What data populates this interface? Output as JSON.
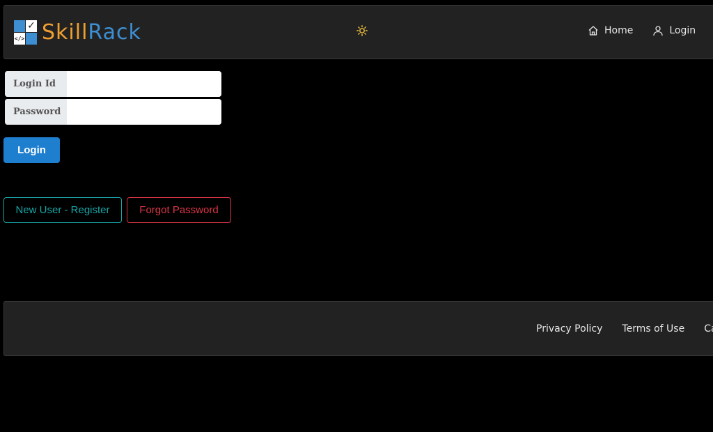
{
  "brand": {
    "part1": "Skill",
    "part2": "Rack",
    "logo_check": "✓",
    "logo_code": "</>"
  },
  "header": {
    "theme_icon": "sun-icon",
    "nav": [
      {
        "label": "Home",
        "icon": "home-icon"
      },
      {
        "label": "Login",
        "icon": "user-icon"
      }
    ]
  },
  "form": {
    "login_id_label": "Login Id",
    "login_id_value": "",
    "password_label": "Password",
    "password_value": "",
    "login_button": "Login",
    "register_button": "New User - Register",
    "forgot_button": "Forgot Password"
  },
  "footer": {
    "links": [
      "Privacy Policy",
      "Terms of Use",
      "Cance"
    ]
  },
  "colors": {
    "background": "#000000",
    "panel": "#222222",
    "primary": "#1f7fcf",
    "teal": "#18a5a5",
    "danger": "#dc3545",
    "brand_orange": "#f0a030",
    "brand_blue": "#3d8fd1"
  }
}
